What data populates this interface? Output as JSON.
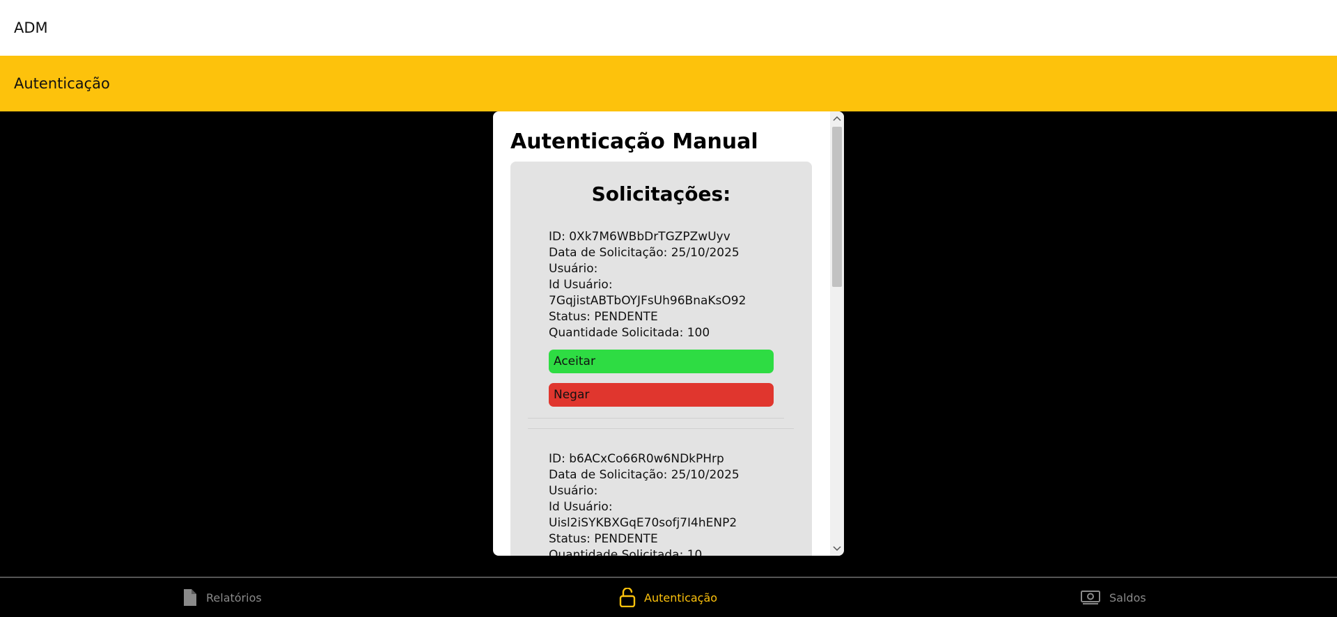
{
  "app": {
    "title": "ADM"
  },
  "page": {
    "header_title": "Autenticação"
  },
  "panel": {
    "title": "Autenticação Manual",
    "requests_heading": "Solicitações:",
    "requests": [
      {
        "id_line": "ID: 0Xk7M6WBbDrTGZPZwUyv",
        "date_line": "Data de Solicitação: 25/10/2025",
        "user_line": "Usuário:",
        "user_id_label": "Id Usuário:",
        "user_id_value": "7GqjistABTbOYJFsUh96BnaKsO92",
        "status_line": "Status: PENDENTE",
        "quantity_line": "Quantidade Solicitada: 100",
        "accept_label": "Aceitar",
        "deny_label": "Negar"
      },
      {
        "id_line": "ID: b6ACxCo66R0w6NDkPHrp",
        "date_line": "Data de Solicitação: 25/10/2025",
        "user_line": "Usuário:",
        "user_id_label": "Id Usuário:",
        "user_id_value": "Uisl2iSYKBXGqE70sofj7I4hENP2",
        "status_line": "Status: PENDENTE",
        "quantity_line": "Quantidade Solicitada: 10"
      }
    ]
  },
  "nav": {
    "items": [
      {
        "label": "Relatórios",
        "icon": "document-icon",
        "active": false
      },
      {
        "label": "Autenticação",
        "icon": "unlock-icon",
        "active": true
      },
      {
        "label": "Saldos",
        "icon": "money-icon",
        "active": false
      }
    ]
  },
  "colors": {
    "accent": "#fdc20c",
    "accept": "#2edc43",
    "deny": "#e0362e",
    "card": "#e3e3e3",
    "nav_inactive": "#8a8a8a"
  }
}
